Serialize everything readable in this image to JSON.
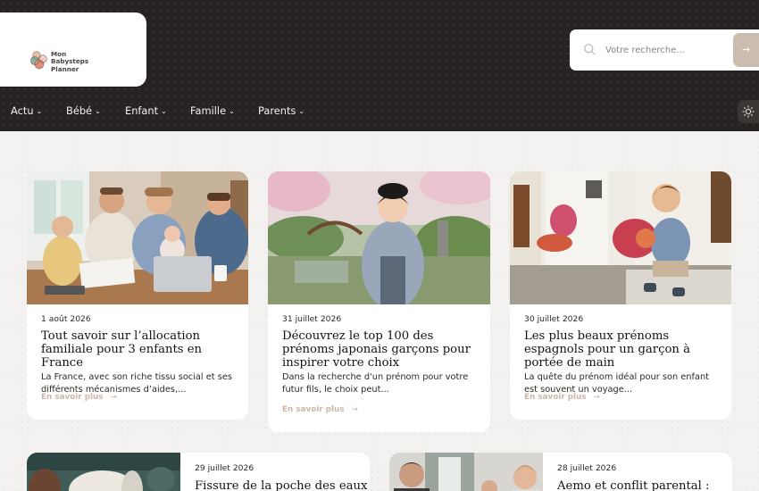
{
  "site": {
    "logo_lines": [
      "Mon",
      "Babysteps",
      "Planner"
    ]
  },
  "search": {
    "placeholder": "Votre recherche...",
    "submit_icon": "arrow-right-icon"
  },
  "nav": {
    "items": [
      {
        "label": "Actu"
      },
      {
        "label": "Bébé"
      },
      {
        "label": "Enfant"
      },
      {
        "label": "Famille"
      },
      {
        "label": "Parents"
      }
    ],
    "theme_toggle_icon": "sun-icon"
  },
  "colors": {
    "header_bg": "#262322",
    "accent": "#cdb6a7",
    "page_bg": "#f4f2f0"
  },
  "articles": [
    {
      "date": "1 août 2026",
      "title": "Tout savoir sur l’allocation familiale pour 3 enfants en France",
      "excerpt": "La France, avec son riche tissu social et ses différents mécanismes d’aides,...",
      "link": "En savoir plus",
      "image": "family-with-documents-photo"
    },
    {
      "date": "31 juillet 2026",
      "title": "Découvrez le top 100 des prénoms japonais garçons pour inspirer votre choix",
      "excerpt": "Dans la recherche d'un prénom pour votre futur fils, le choix peut...",
      "link": "En savoir plus",
      "image": "boy-in-kimono-garden-photo"
    },
    {
      "date": "30 juillet 2026",
      "title": "Les plus beaux prénoms espagnols pour un garçon à portée de main",
      "excerpt": "La quête du prénom idéal pour son enfant est souvent un voyage...",
      "link": "En savoir plus",
      "image": "boy-in-spanish-street-photo"
    },
    {
      "date": "29 juillet 2026",
      "title": "Fissure de la poche des eaux :",
      "image": "paper-roll-photo"
    },
    {
      "date": "28 juillet 2026",
      "title": "Aemo et conflit parental :",
      "image": "parents-conflict-photo"
    }
  ]
}
